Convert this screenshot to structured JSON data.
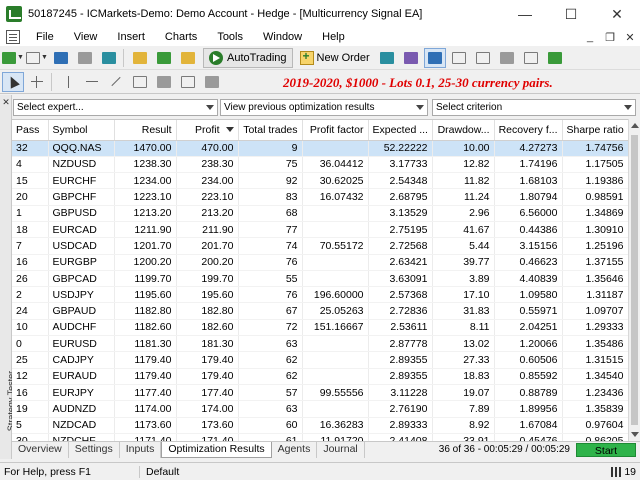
{
  "window": {
    "title": "50187245 - ICMarkets-Demo: Demo Account - Hedge - [Multicurrency Signal EA]",
    "minimize": "—",
    "maximize": "☐",
    "close": "✕"
  },
  "menu": {
    "items": [
      "File",
      "View",
      "Insert",
      "Charts",
      "Tools",
      "Window",
      "Help"
    ],
    "right_controls": [
      "_",
      "❐",
      "✕"
    ]
  },
  "toolbar": {
    "autotrading_label": "AutoTrading",
    "neworder_label": "New Order"
  },
  "banner": "2019-2020, $1000 - Lots 0.1, 25-30 currency pairs.",
  "filters": {
    "expert": "Select expert...",
    "results": "View previous optimization results",
    "criterion": "Select criterion"
  },
  "table": {
    "columns": [
      "Pass",
      "Symbol",
      "Result",
      "Profit",
      "Total trades",
      "Profit factor",
      "Expected ...",
      "Drawdow...",
      "Recovery f...",
      "Sharpe ratio"
    ],
    "rows": [
      [
        "32",
        "QQQ.NAS",
        "1470.00",
        "470.00",
        "9",
        "",
        "52.22222",
        "10.00",
        "4.27273",
        "1.74756"
      ],
      [
        "4",
        "NZDUSD",
        "1238.30",
        "238.30",
        "75",
        "36.04412",
        "3.17733",
        "12.82",
        "1.74196",
        "1.17505"
      ],
      [
        "15",
        "EURCHF",
        "1234.00",
        "234.00",
        "92",
        "30.62025",
        "2.54348",
        "11.82",
        "1.68103",
        "1.19386"
      ],
      [
        "20",
        "GBPCHF",
        "1223.10",
        "223.10",
        "83",
        "16.07432",
        "2.68795",
        "11.24",
        "1.80794",
        "0.98591"
      ],
      [
        "1",
        "GBPUSD",
        "1213.20",
        "213.20",
        "68",
        "",
        "3.13529",
        "2.96",
        "6.56000",
        "1.34869"
      ],
      [
        "18",
        "EURCAD",
        "1211.90",
        "211.90",
        "77",
        "",
        "2.75195",
        "41.67",
        "0.44386",
        "1.30910"
      ],
      [
        "7",
        "USDCAD",
        "1201.70",
        "201.70",
        "74",
        "70.55172",
        "2.72568",
        "5.44",
        "3.15156",
        "1.25196"
      ],
      [
        "16",
        "EURGBP",
        "1200.20",
        "200.20",
        "76",
        "",
        "2.63421",
        "39.77",
        "0.46623",
        "1.37155"
      ],
      [
        "26",
        "GBPCAD",
        "1199.70",
        "199.70",
        "55",
        "",
        "3.63091",
        "3.89",
        "4.40839",
        "1.35646"
      ],
      [
        "2",
        "USDJPY",
        "1195.60",
        "195.60",
        "76",
        "196.60000",
        "2.57368",
        "17.10",
        "1.09580",
        "1.31187"
      ],
      [
        "24",
        "GBPAUD",
        "1182.80",
        "182.80",
        "67",
        "25.05263",
        "2.72836",
        "31.83",
        "0.55971",
        "1.09707"
      ],
      [
        "10",
        "AUDCHF",
        "1182.60",
        "182.60",
        "72",
        "151.16667",
        "2.53611",
        "8.11",
        "2.04251",
        "1.29333"
      ],
      [
        "0",
        "EURUSD",
        "1181.30",
        "181.30",
        "63",
        "",
        "2.87778",
        "13.02",
        "1.20066",
        "1.35486"
      ],
      [
        "25",
        "CADJPY",
        "1179.40",
        "179.40",
        "62",
        "",
        "2.89355",
        "27.33",
        "0.60506",
        "1.31515"
      ],
      [
        "12",
        "EURAUD",
        "1179.40",
        "179.40",
        "62",
        "",
        "2.89355",
        "18.83",
        "0.85592",
        "1.34540"
      ],
      [
        "16",
        "EURJPY",
        "1177.40",
        "177.40",
        "57",
        "99.55556",
        "3.11228",
        "19.07",
        "0.88789",
        "1.23436"
      ],
      [
        "19",
        "AUDNZD",
        "1174.00",
        "174.00",
        "63",
        "",
        "2.76190",
        "7.89",
        "1.89956",
        "1.35839"
      ],
      [
        "5",
        "NZDCAD",
        "1173.60",
        "173.60",
        "60",
        "16.36283",
        "2.89333",
        "8.92",
        "1.67084",
        "0.97604"
      ],
      [
        "30",
        "NZDCHF",
        "1171.40",
        "171.40",
        "61",
        "11.91720",
        "2.41408",
        "33.91",
        "0.45476",
        "0.86205"
      ]
    ]
  },
  "tabs": [
    "Overview",
    "Settings",
    "Inputs",
    "Optimization Results",
    "Agents",
    "Journal"
  ],
  "progress": "36 of 36 - 00:05:29 / 00:05:29",
  "start_label": "Start",
  "side_label": "Strategy Tester",
  "side_close": "✕",
  "status": {
    "help": "For Help, press F1",
    "profile": "Default",
    "right": "19"
  },
  "colors": {
    "selected_row": "#cde3f7",
    "banner_text": "#e00000",
    "start_button": "#2fb34a"
  }
}
